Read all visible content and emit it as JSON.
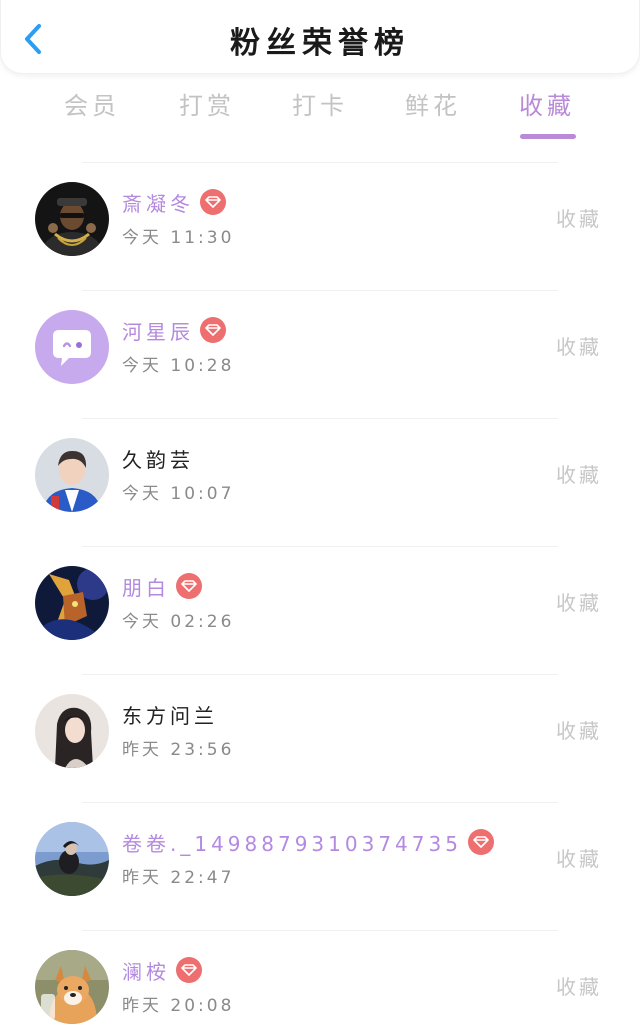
{
  "header": {
    "title": "粉丝荣誉榜",
    "back_icon": "chevron-left-icon"
  },
  "tabs": [
    {
      "label": "会员"
    },
    {
      "label": "打赏"
    },
    {
      "label": "打卡"
    },
    {
      "label": "鲜花"
    },
    {
      "label": "收藏",
      "active": true
    }
  ],
  "accent_color": "#b88ad8",
  "vip_badge_color": "#ee6f6f",
  "fans": [
    {
      "name": "斎凝冬",
      "time": "今天 11:30",
      "vip": true,
      "action": "收藏",
      "avatar": "rapper-gold-chains"
    },
    {
      "name": "河星辰",
      "time": "今天 10:28",
      "vip": true,
      "action": "收藏",
      "avatar": "purple-chat-bubble"
    },
    {
      "name": "久韵芸",
      "time": "今天 10:07",
      "vip": false,
      "action": "收藏",
      "avatar": "boy-blue-jacket"
    },
    {
      "name": "朋白",
      "time": "今天 02:26",
      "vip": true,
      "action": "收藏",
      "avatar": "fantasy-warrior"
    },
    {
      "name": "东方问兰",
      "time": "昨天 23:56",
      "vip": false,
      "action": "收藏",
      "avatar": "girl-long-hair"
    },
    {
      "name": "卷卷._1498879310374735",
      "time": "昨天 22:47",
      "vip": true,
      "action": "收藏",
      "avatar": "scenic-person"
    },
    {
      "name": "澜桉",
      "time": "昨天 20:08",
      "vip": true,
      "action": "收藏",
      "avatar": "shiba-dog"
    }
  ]
}
